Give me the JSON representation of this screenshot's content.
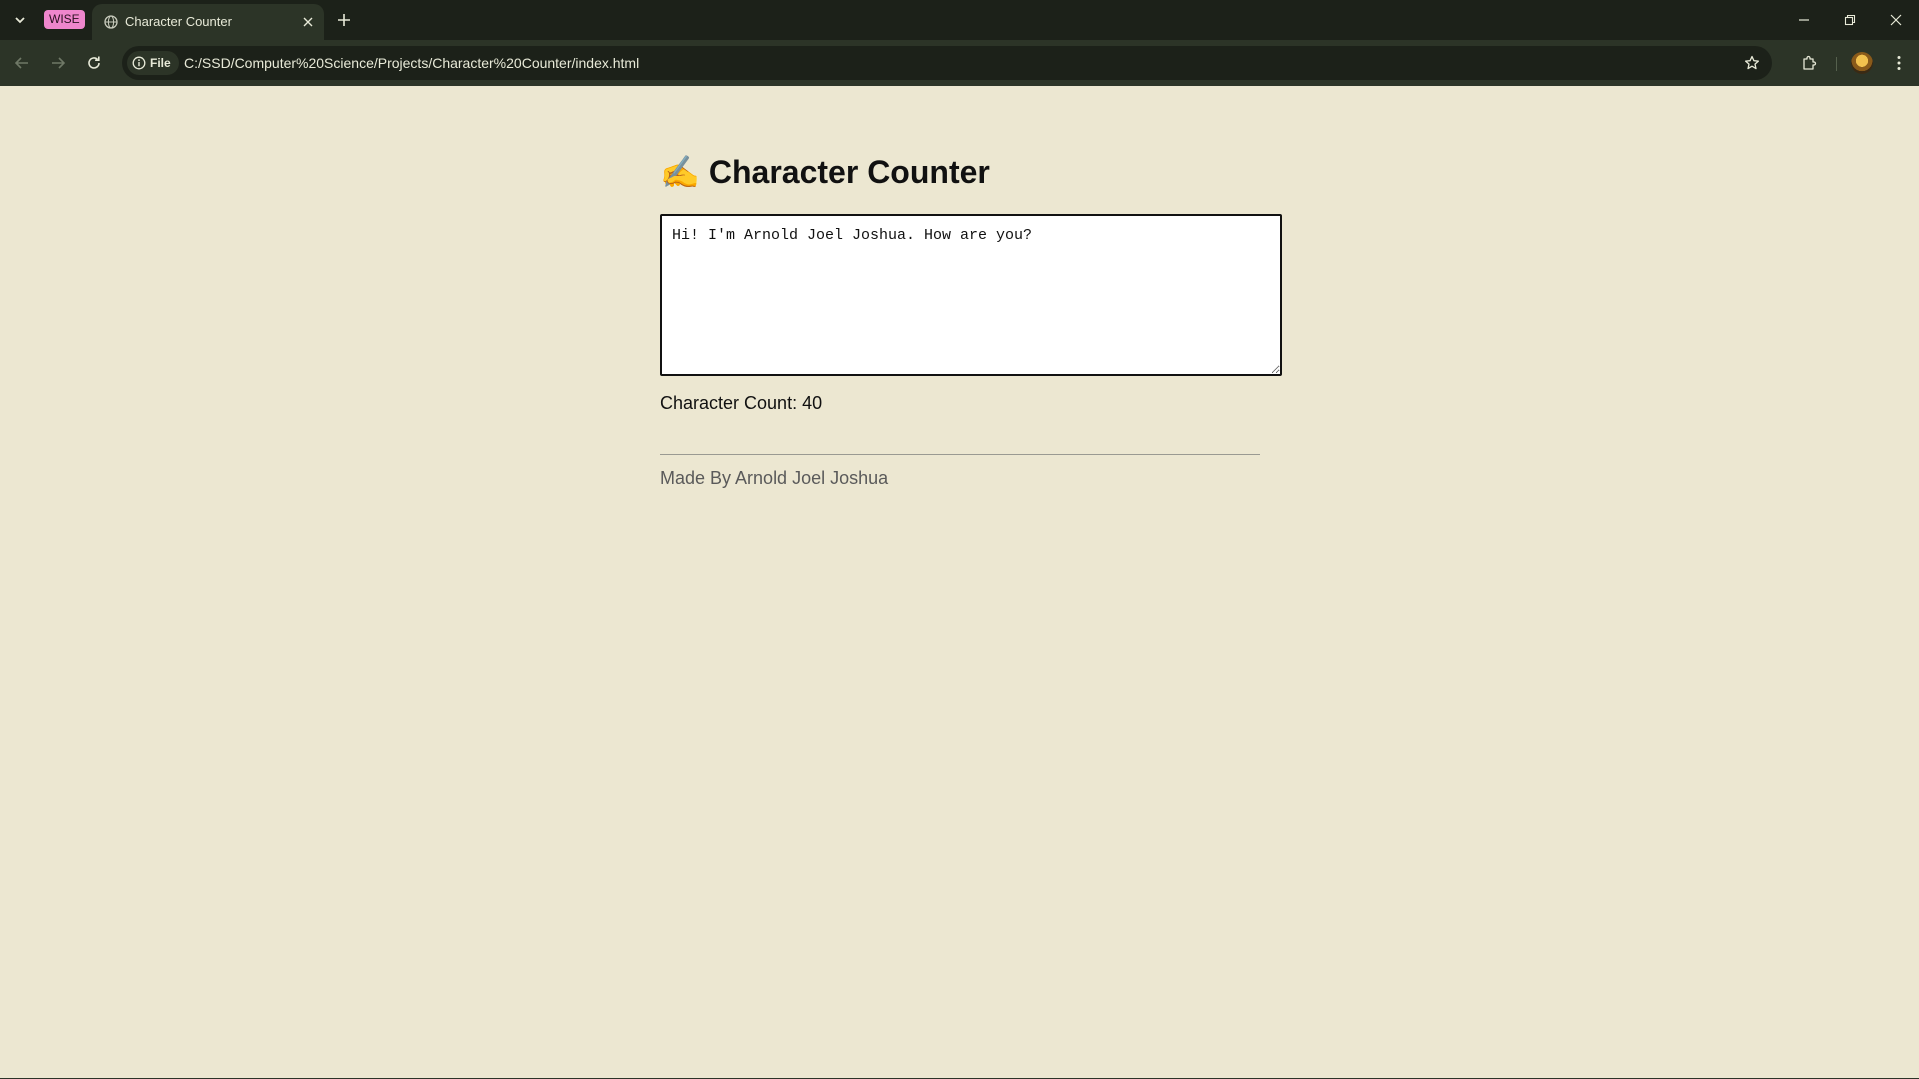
{
  "browser": {
    "tab_group_label": "WISE",
    "tab_title": "Character Counter",
    "site_info_label": "File",
    "url": "C:/SSD/Computer%20Science/Projects/Character%20Counter/index.html",
    "colors": {
      "tabbar_bg": "#1c2119",
      "toolbar_bg": "#2c3427",
      "group_chip": "#ee86cc"
    },
    "icons": [
      "chevron-down-icon",
      "globe-icon",
      "close-icon",
      "plus-icon",
      "back-icon",
      "forward-icon",
      "reload-icon",
      "info-icon",
      "star-icon",
      "extensions-icon",
      "avatar",
      "more-vert-icon",
      "minimize-icon",
      "restore-icon",
      "window-close-icon"
    ]
  },
  "page": {
    "background": "#ece7d1",
    "title_emoji": "✍️",
    "title": "Character Counter",
    "textarea_value": "Hi! I'm Arnold Joel Joshua. How are you?",
    "count_label": "Character Count:",
    "count_value": "40",
    "footer": "Made By Arnold Joel Joshua"
  }
}
